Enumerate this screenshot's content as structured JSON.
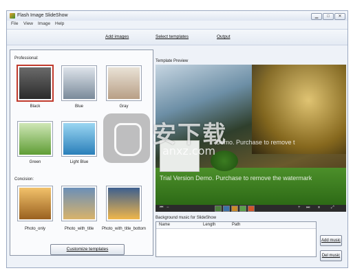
{
  "window": {
    "title": "Flash Image SlideShow"
  },
  "menu": [
    "File",
    "View",
    "Image",
    "Help"
  ],
  "toolbar": {
    "add_images": "Add images",
    "select_templates": "Select templates",
    "output": "Output"
  },
  "templates": {
    "professional_label": "Professional:",
    "concision_label": "Concision:",
    "professional": [
      {
        "name": "Black"
      },
      {
        "name": "Blue"
      },
      {
        "name": "Gray"
      },
      {
        "name": "Green"
      },
      {
        "name": "Light Blue"
      }
    ],
    "concision": [
      {
        "name": "Photo_only"
      },
      {
        "name": "Photo_with_title"
      },
      {
        "name": "Photo_with_title_bottom"
      }
    ],
    "customize_button": "Customize templates"
  },
  "preview": {
    "label": "Template Preview",
    "watermark": "Trial Version Demo. Purchase to remove the watermark",
    "watermark_top": "Demo. Purchase to remove t"
  },
  "music": {
    "label": "Background music for SlideShow",
    "columns": [
      "Name",
      "Length",
      "Path"
    ],
    "add_button": "Add music",
    "del_button": "Del music"
  },
  "overlay": {
    "logo_text": "安下载",
    "url": "anxz.com"
  },
  "colors": {
    "selected_border": "#c0392b",
    "panel_border": "#8d97a8"
  }
}
